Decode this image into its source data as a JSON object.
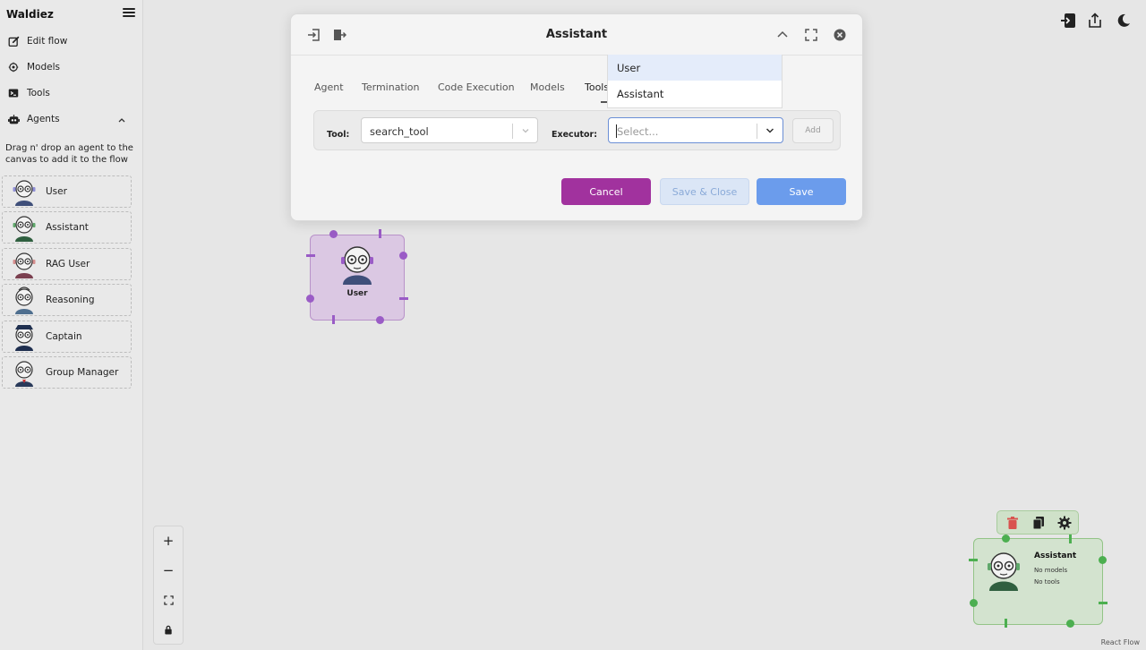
{
  "app": {
    "title": "Waldiez"
  },
  "sidebar": {
    "nav": [
      {
        "label": "Edit flow",
        "icon": "edit-icon"
      },
      {
        "label": "Models",
        "icon": "models-icon"
      },
      {
        "label": "Tools",
        "icon": "terminal-icon"
      },
      {
        "label": "Agents",
        "icon": "robot-icon"
      }
    ],
    "help_text": "Drag n' drop an agent to the canvas to add it to the flow",
    "agents": [
      {
        "label": "User"
      },
      {
        "label": "Assistant"
      },
      {
        "label": "RAG User"
      },
      {
        "label": "Reasoning"
      },
      {
        "label": "Captain"
      },
      {
        "label": "Group Manager"
      }
    ]
  },
  "modal": {
    "title": "Assistant",
    "tabs": [
      "Agent",
      "Termination",
      "Code Execution",
      "Models",
      "Tools"
    ],
    "active_tab": "Tools",
    "tool_label": "Tool:",
    "tool_value": "search_tool",
    "executor_label": "Executor:",
    "executor_placeholder": "Select...",
    "add_label": "Add",
    "cancel_label": "Cancel",
    "save_close_label": "Save & Close",
    "save_label": "Save"
  },
  "executor_menu": {
    "options": [
      "User",
      "Assistant"
    ],
    "highlighted": "User"
  },
  "canvas": {
    "user_node": {
      "label": "User"
    },
    "assistant_node": {
      "name": "Assistant",
      "models": "No models",
      "tools": "No tools"
    },
    "attribution": "React Flow"
  },
  "colors": {
    "accent_purple": "#a1329e",
    "save_blue": "#6b9cec",
    "user_node_fill": "#dbc8e3",
    "user_handle": "#9a5cc6",
    "assistant_node_fill": "#d3e3cf",
    "assistant_handle": "#4caf50",
    "delete_red": "#d9534f"
  }
}
